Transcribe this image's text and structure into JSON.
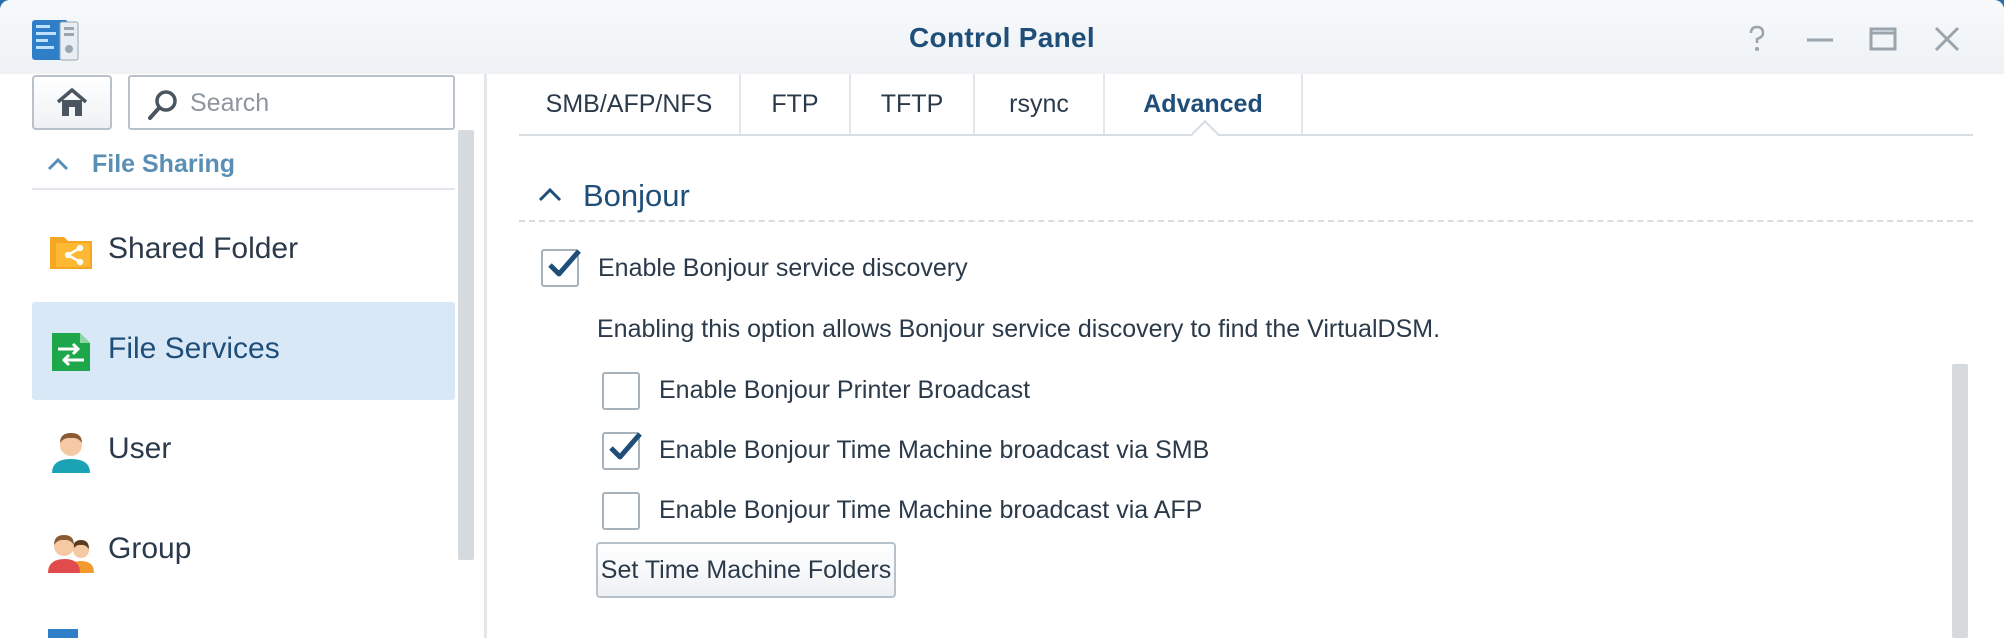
{
  "window": {
    "title": "Control Panel"
  },
  "sidebar": {
    "search_placeholder": "Search",
    "section_label": "File Sharing",
    "items": [
      {
        "label": "Shared Folder",
        "icon": "shared-folder-icon",
        "active": false
      },
      {
        "label": "File Services",
        "icon": "file-services-icon",
        "active": true
      },
      {
        "label": "User",
        "icon": "user-icon",
        "active": false
      },
      {
        "label": "Group",
        "icon": "group-icon",
        "active": false
      }
    ]
  },
  "tabs": [
    {
      "label": "SMB/AFP/NFS",
      "active": false
    },
    {
      "label": "FTP",
      "active": false
    },
    {
      "label": "TFTP",
      "active": false
    },
    {
      "label": "rsync",
      "active": false
    },
    {
      "label": "Advanced",
      "active": true
    }
  ],
  "bonjour": {
    "title": "Bonjour",
    "enable_label": "Enable Bonjour service discovery",
    "enable_checked": true,
    "description": "Enabling this option allows Bonjour service discovery to find the VirtualDSM.",
    "options": [
      {
        "label": "Enable Bonjour Printer Broadcast",
        "checked": false
      },
      {
        "label": "Enable Bonjour Time Machine broadcast via SMB",
        "checked": true
      },
      {
        "label": "Enable Bonjour Time Machine broadcast via AFP",
        "checked": false
      }
    ],
    "button_label": "Set Time Machine Folders"
  },
  "colors": {
    "accent": "#1f4e79",
    "section_header": "#5a8fb5",
    "active_item_bg": "#d9e8f7",
    "check_mark": "#1f4e79"
  }
}
